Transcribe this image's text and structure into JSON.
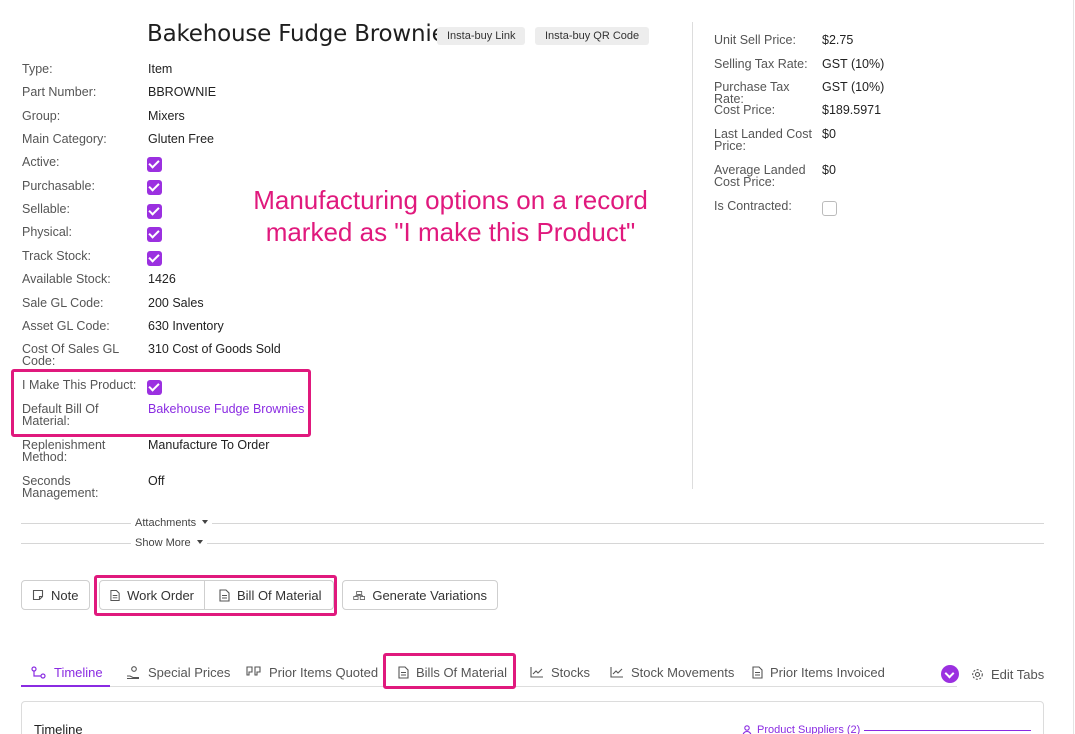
{
  "product": {
    "title": "Bakehouse Fudge Brownie",
    "insta_buy_link": "Insta-buy Link",
    "insta_buy_qr": "Insta-buy QR Code"
  },
  "fields": {
    "type": {
      "label": "Type:",
      "value": "Item"
    },
    "part_number": {
      "label": "Part Number:",
      "value": "BBROWNIE"
    },
    "group": {
      "label": "Group:",
      "value": "Mixers"
    },
    "main_category": {
      "label": "Main Category:",
      "value": "Gluten Free"
    },
    "active": {
      "label": "Active:",
      "checked": true
    },
    "purchasable": {
      "label": "Purchasable:",
      "checked": true
    },
    "sellable": {
      "label": "Sellable:",
      "checked": true
    },
    "physical": {
      "label": "Physical:",
      "checked": true
    },
    "track_stock": {
      "label": "Track Stock:",
      "checked": true
    },
    "available_stock": {
      "label": "Available Stock:",
      "value": "1426"
    },
    "sale_gl_code": {
      "label": "Sale GL Code:",
      "value": "200 Sales"
    },
    "asset_gl_code": {
      "label": "Asset GL Code:",
      "value": "630 Inventory"
    },
    "cost_of_sales_gl": {
      "label": "Cost Of Sales GL Code:",
      "value": "310 Cost of Goods Sold"
    },
    "i_make_this_product": {
      "label": "I Make This Product:",
      "checked": true
    },
    "default_bom": {
      "label": "Default Bill Of Material:",
      "value": "Bakehouse Fudge Brownies"
    },
    "replenishment_method": {
      "label": "Replenishment Method:",
      "value": "Manufacture To Order"
    },
    "seconds_management": {
      "label": "Seconds Management:",
      "value": "Off"
    }
  },
  "pricing": {
    "unit_sell_price": {
      "label": "Unit Sell Price:",
      "value": "$2.75"
    },
    "selling_tax_rate": {
      "label": "Selling Tax Rate:",
      "value": "GST (10%)"
    },
    "purchase_tax_rate": {
      "label": "Purchase Tax Rate:",
      "value": "GST (10%)"
    },
    "cost_price": {
      "label": "Cost Price:",
      "value": "$189.5971"
    },
    "last_landed_cost": {
      "label": "Last Landed Cost Price:",
      "value": "$0"
    },
    "average_landed_cost": {
      "label": "Average Landed Cost Price:",
      "value": "$0"
    },
    "is_contracted": {
      "label": "Is Contracted:",
      "checked": false
    }
  },
  "annotation": {
    "text": "Manufacturing options on a record marked as \"I make this Product\"",
    "color": "#e0197d"
  },
  "sections": {
    "attachments": "Attachments",
    "show_more": "Show More"
  },
  "actions": {
    "note": "Note",
    "work_order": "Work Order",
    "bill_of_material": "Bill Of Material",
    "generate_variations": "Generate Variations"
  },
  "tabs": {
    "timeline": "Timeline",
    "special_prices": "Special Prices",
    "prior_items_quoted": "Prior Items Quoted",
    "bills_of_material": "Bills Of Material",
    "stocks": "Stocks",
    "stock_movements": "Stock Movements",
    "prior_items_invoiced": "Prior Items Invoiced",
    "edit_tabs": "Edit Tabs"
  },
  "panel": {
    "title": "Timeline",
    "product_suppliers": "Product Suppliers (2)"
  },
  "colors": {
    "accent": "#8a2be2",
    "checkbox": "#9b30e0",
    "highlight": "#e0197d"
  }
}
